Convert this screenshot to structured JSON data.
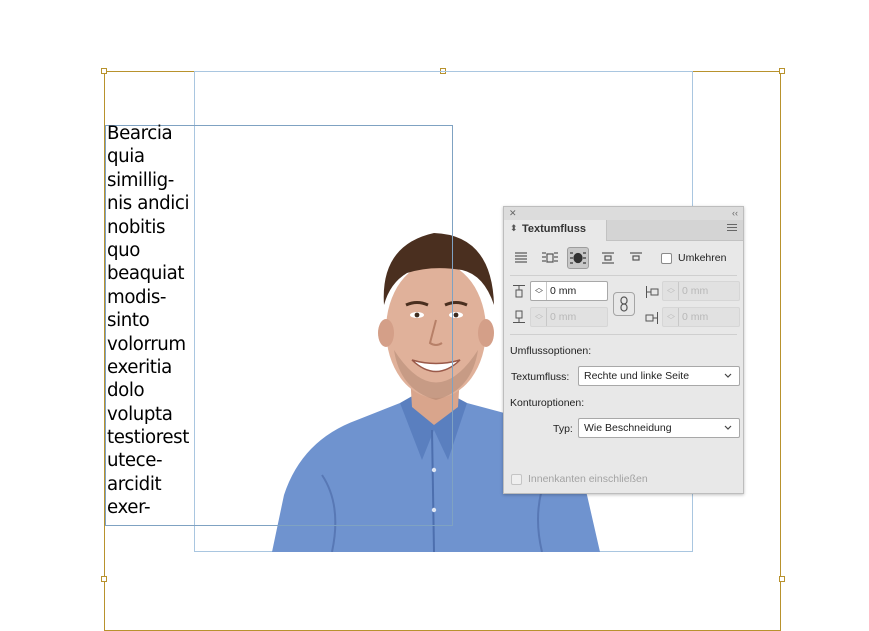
{
  "canvas": {
    "body_text_lines": [
      "Bearcia",
      "quia",
      "simillig-",
      "nis andici",
      "nobitis",
      "quo",
      "beaquiat",
      "modis-",
      "sinto",
      "volorrum",
      "exeritia",
      "dolo",
      "volupta",
      "testiorest",
      "utece-",
      "arcidit",
      "exer-"
    ]
  },
  "panel": {
    "title": "Textumfluss",
    "invert_label": "Umkehren",
    "offsets": {
      "top_value": "0 mm",
      "bottom_value": "0 mm",
      "left_value": "0 mm",
      "right_value": "0 mm"
    },
    "wrap_options_label": "Umflussoptionen:",
    "wrap_to_label": "Textumfluss:",
    "wrap_to_value": "Rechte und linke Seite",
    "contour_options_label": "Konturoptionen:",
    "type_label": "Typ:",
    "type_value": "Wie Beschneidung",
    "include_inside_edges_label": "Innenkanten einschließen"
  },
  "colors": {
    "frame_gold": "#b8922d",
    "frame_blue": "#a9c6e0",
    "shirt_blue": "#6f93cf"
  }
}
